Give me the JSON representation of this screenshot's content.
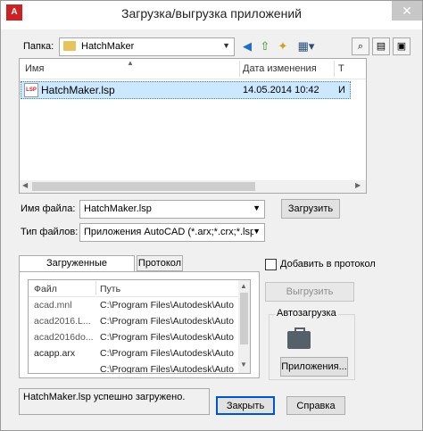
{
  "window": {
    "title": "Загрузка/выгрузка приложений"
  },
  "folder": {
    "label": "Папка:",
    "value": "HatchMaker"
  },
  "toolbar": {
    "back_icon": "back-arrow-icon",
    "up_icon": "up-folder-icon",
    "new_folder_icon": "new-folder-icon",
    "views_icon": "views-menu-icon",
    "right_icons": [
      "find-icon",
      "properties-icon",
      "preview-icon"
    ]
  },
  "file_list": {
    "columns": [
      "Имя",
      "Дата изменения",
      "Т"
    ],
    "rows": [
      {
        "name": "HatchMaker.lsp",
        "date": "14.05.2014 10:42",
        "type": "И"
      }
    ]
  },
  "file_name": {
    "label": "Имя файла:",
    "value": "HatchMaker.lsp"
  },
  "file_type": {
    "label": "Тип файлов:",
    "value": "Приложения AutoCAD (*.arx;*.crx;*.lsp;*.dvt"
  },
  "load_button": "Загрузить",
  "tabs": {
    "loaded": "Загруженные приложения",
    "log": "Протокол"
  },
  "loaded_list": {
    "columns": [
      "Файл",
      "Путь"
    ],
    "rows": [
      {
        "file": "acad.mnl",
        "path": "C:\\Program Files\\Autodesk\\AutoCA..."
      },
      {
        "file": "acad2016.L...",
        "path": "C:\\Program Files\\Autodesk\\AutoCA..."
      },
      {
        "file": "acad2016do...",
        "path": "C:\\Program Files\\Autodesk\\AutoCA..."
      },
      {
        "file": "acapp.arx",
        "path": "C:\\Program Files\\Autodesk\\AutoCA..."
      },
      {
        "file": "",
        "path": "C:\\Program Files\\Autodesk\\AutoCA..."
      }
    ]
  },
  "add_to_log": "Добавить в протокол",
  "unload_button": "Выгрузить",
  "startup": {
    "label": "Автозагрузка",
    "button": "Приложения..."
  },
  "status_text": "HatchMaker.lsp успешно загружено.",
  "close_button": "Закрыть",
  "help_button": "Справка"
}
